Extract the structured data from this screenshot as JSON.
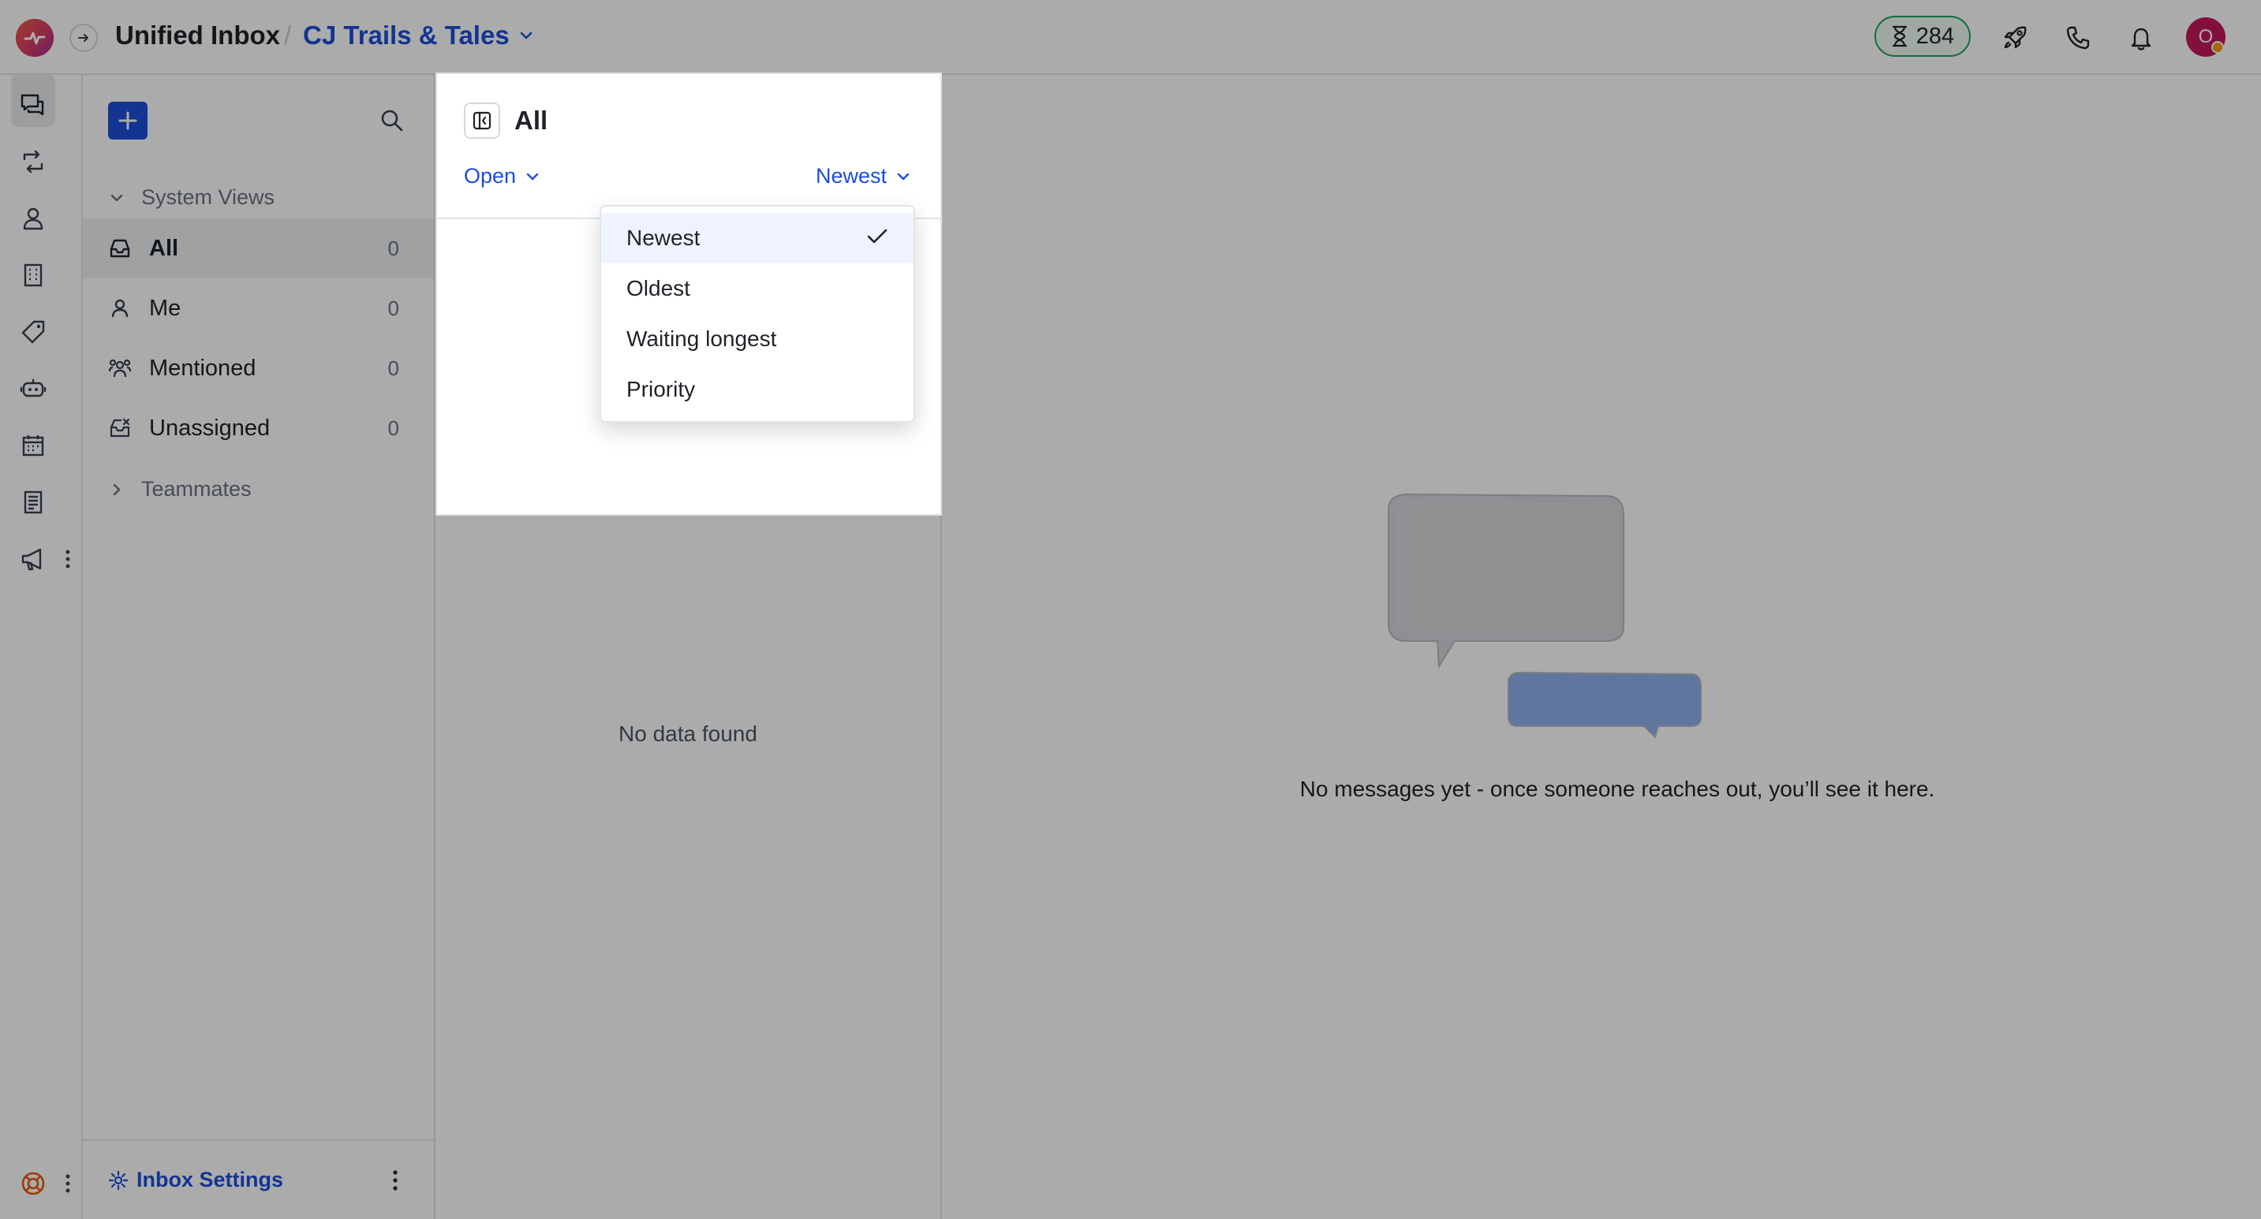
{
  "header": {
    "title": "Unified Inbox",
    "separator": "/",
    "location": "CJ Trails & Tales",
    "credits": "284",
    "avatar_initial": "O"
  },
  "sidebar": {
    "section_system": "System Views",
    "items": [
      {
        "label": "All",
        "count": "0"
      },
      {
        "label": "Me",
        "count": "0"
      },
      {
        "label": "Mentioned",
        "count": "0"
      },
      {
        "label": "Unassigned",
        "count": "0"
      }
    ],
    "section_team": "Teammates",
    "footer_label": "Inbox Settings"
  },
  "list": {
    "title": "All",
    "status_filter": "Open",
    "sort_label": "Newest",
    "empty_text": "No data found"
  },
  "sort_menu": {
    "options": [
      "Newest",
      "Oldest",
      "Waiting longest",
      "Priority"
    ],
    "selected": "Newest"
  },
  "main": {
    "empty_text": "No messages yet - once someone reaches out, you’ll see it here."
  },
  "colors": {
    "accent": "#1d4ed8",
    "credit_border": "#22a05a",
    "avatar": "#c2185b"
  }
}
